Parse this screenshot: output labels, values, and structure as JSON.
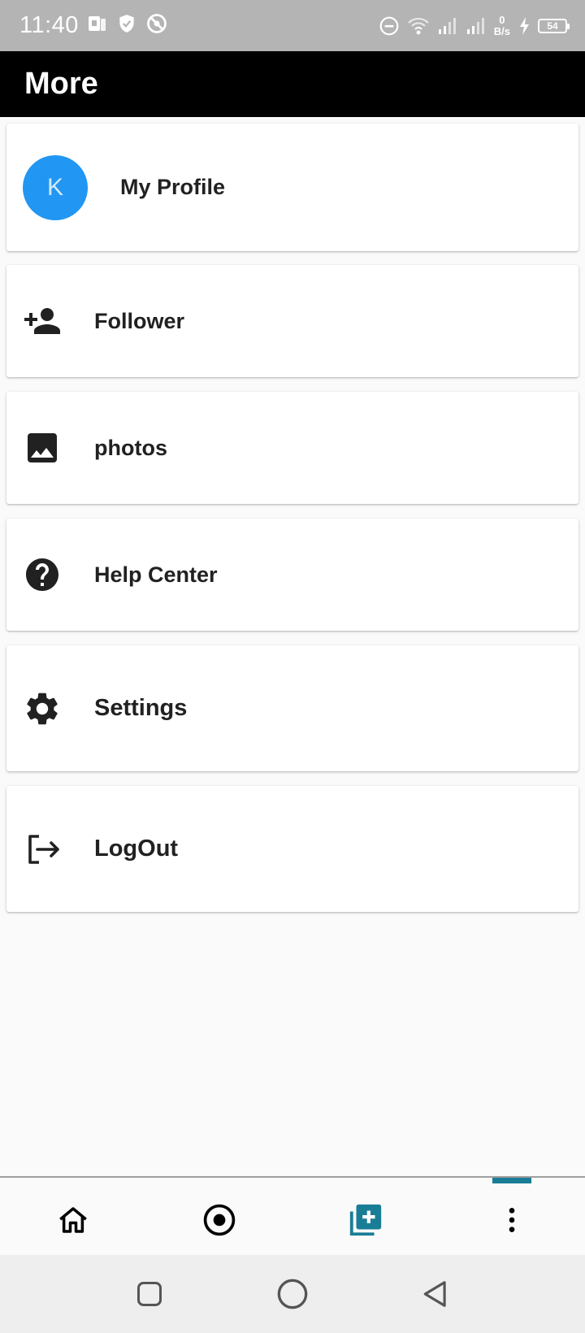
{
  "status_bar": {
    "time": "11:40",
    "net_speed_value": "0",
    "net_speed_unit": "B/s",
    "battery": "54",
    "icons": [
      "notification-app-icon",
      "shield-icon",
      "no-disturb-icon",
      "dnd-icon",
      "wifi-icon",
      "signal-icon",
      "signal-icon",
      "charging-icon",
      "battery-icon"
    ]
  },
  "app_bar": {
    "title": "More"
  },
  "profile": {
    "avatar_letter": "K",
    "avatar_color": "#2196f3",
    "label": "My Profile"
  },
  "menu": {
    "follower": {
      "label": "Follower",
      "icon": "person-add-icon"
    },
    "photos": {
      "label": "photos",
      "icon": "image-icon"
    },
    "help": {
      "label": "Help Center",
      "icon": "help-circle-icon"
    },
    "settings": {
      "label": "Settings",
      "icon": "gear-icon"
    },
    "logout": {
      "label": "LogOut",
      "icon": "logout-icon"
    }
  },
  "bottom_nav": {
    "items": [
      "home-icon",
      "record-icon",
      "add-photo-icon",
      "more-vertical-icon"
    ],
    "active_index": 2,
    "accent_color": "#1a7d96"
  },
  "system_nav": {
    "items": [
      "recents-icon",
      "home-circle-icon",
      "back-icon"
    ]
  }
}
